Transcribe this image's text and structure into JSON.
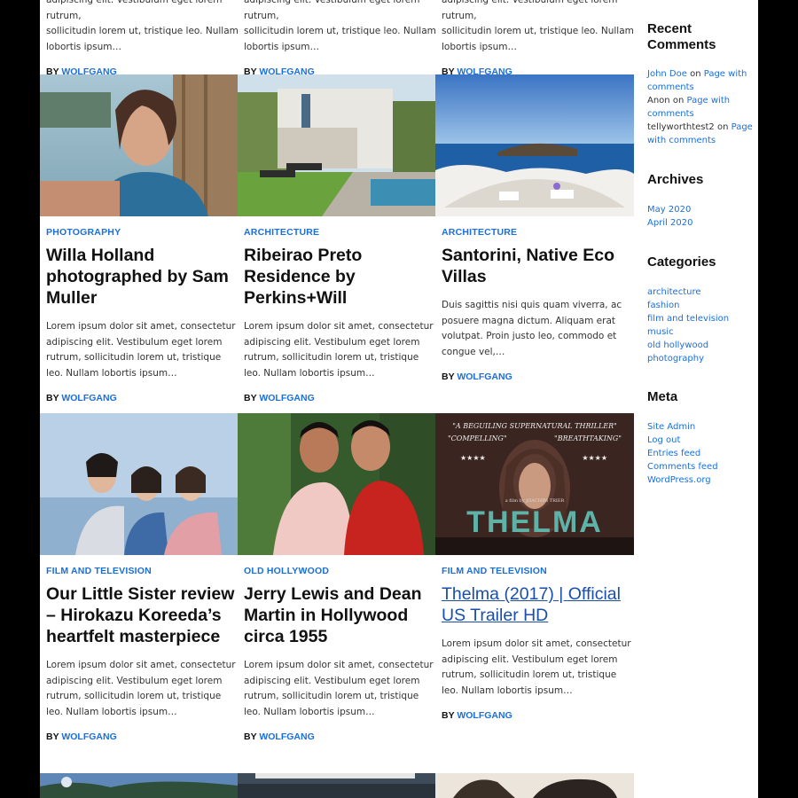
{
  "excerpt_short": "Lorem ipsum dolor sit amet, consectetur adipiscing elit. Vestibulum eget lorem rutrum, sollicitudin lorem ut, tristique leo. Nullam lobortis ipsum…",
  "top_row": {
    "lines": [
      "adipiscing elit. Vestibulum eget lorem rutrum,",
      "sollicitudin lorem ut, tristique leo. Nullam",
      "lobortis ipsum…"
    ],
    "by": "BY",
    "author": "WOLFGANG"
  },
  "posts": [
    {
      "category": "PHOTOGRAPHY",
      "title": "Willa Holland photographed by Sam Muller",
      "excerpt": "Lorem ipsum dolor sit amet, consectetur adipiscing elit. Vestibulum eget lorem rutrum, sollicitudin lorem ut, tristique leo. Nullam lobortis ipsum…",
      "by": "BY",
      "author": "WOLFGANG"
    },
    {
      "category": "ARCHITECTURE",
      "title": "Ribeirao Preto Residence by Perkins+Will",
      "excerpt": "Lorem ipsum dolor sit amet, consectetur adipiscing elit. Vestibulum eget lorem rutrum, sollicitudin lorem ut, tristique leo. Nullam lobortis ipsum…",
      "by": "BY",
      "author": "WOLFGANG"
    },
    {
      "category": "ARCHITECTURE",
      "title": "Santorini, Native Eco Villas",
      "excerpt": "Duis sagittis nisi quis quam viverra, ac posuere magna dictum. Aliquam erat volutpat. Proin justo leo, commodo et congue vel,…",
      "by": "BY",
      "author": "WOLFGANG"
    },
    {
      "category": "FILM AND TELEVISION",
      "title": "Our Little Sister review – Hirokazu Koreeda’s heartfelt masterpiece",
      "excerpt": "Lorem ipsum dolor sit amet, consectetur adipiscing elit. Vestibulum eget lorem rutrum, sollicitudin lorem ut, tristique leo. Nullam lobortis ipsum…",
      "by": "BY",
      "author": "WOLFGANG"
    },
    {
      "category": "OLD HOLLYWOOD",
      "title": "Jerry Lewis and Dean Martin in Hollywood circa 1955",
      "excerpt": "Lorem ipsum dolor sit amet, consectetur adipiscing elit. Vestibulum eget lorem rutrum, sollicitudin lorem ut, tristique leo. Nullam lobortis ipsum…",
      "by": "BY",
      "author": "WOLFGANG"
    },
    {
      "category": "FILM AND TELEVISION",
      "title": "Thelma (2017) | Official US Trailer HD",
      "excerpt": "Lorem ipsum dolor sit amet, consectetur adipiscing elit. Vestibulum eget lorem rutrum, sollicitudin lorem ut, tristique leo. Nullam lobortis ipsum…",
      "by": "BY",
      "author": "WOLFGANG"
    }
  ],
  "poster": {
    "tagline": "\"A BEGUILING SUPERNATURAL THRILLER\"",
    "quote_left": "\"COMPELLING\"",
    "quote_right": "\"BREATHTAKING\"",
    "stars": "★★★★",
    "title": "THELMA",
    "credit": "a film by JOACHIM TRIER"
  },
  "sidebar": {
    "recent_comments": {
      "heading": "Recent Comments",
      "items": [
        {
          "author": "John Doe",
          "on": "on",
          "post": "Page with comments"
        },
        {
          "author": "Anon",
          "on": "on",
          "post": "Page with comments"
        },
        {
          "author": "tellyworthtest2",
          "on": "on",
          "post": "Page with comments"
        }
      ]
    },
    "archives": {
      "heading": "Archives",
      "items": [
        "May 2020",
        "April 2020"
      ]
    },
    "categories": {
      "heading": "Categories",
      "items": [
        "architecture",
        "fashion",
        "film and television",
        "music",
        "old hollywood",
        "photography"
      ]
    },
    "meta": {
      "heading": "Meta",
      "items": [
        "Site Admin",
        "Log out",
        "Entries feed",
        "Comments feed",
        "WordPress.org"
      ]
    }
  },
  "colors": {
    "accent": "#1a6fdc",
    "background": "#000000",
    "card": "#ffffff"
  }
}
